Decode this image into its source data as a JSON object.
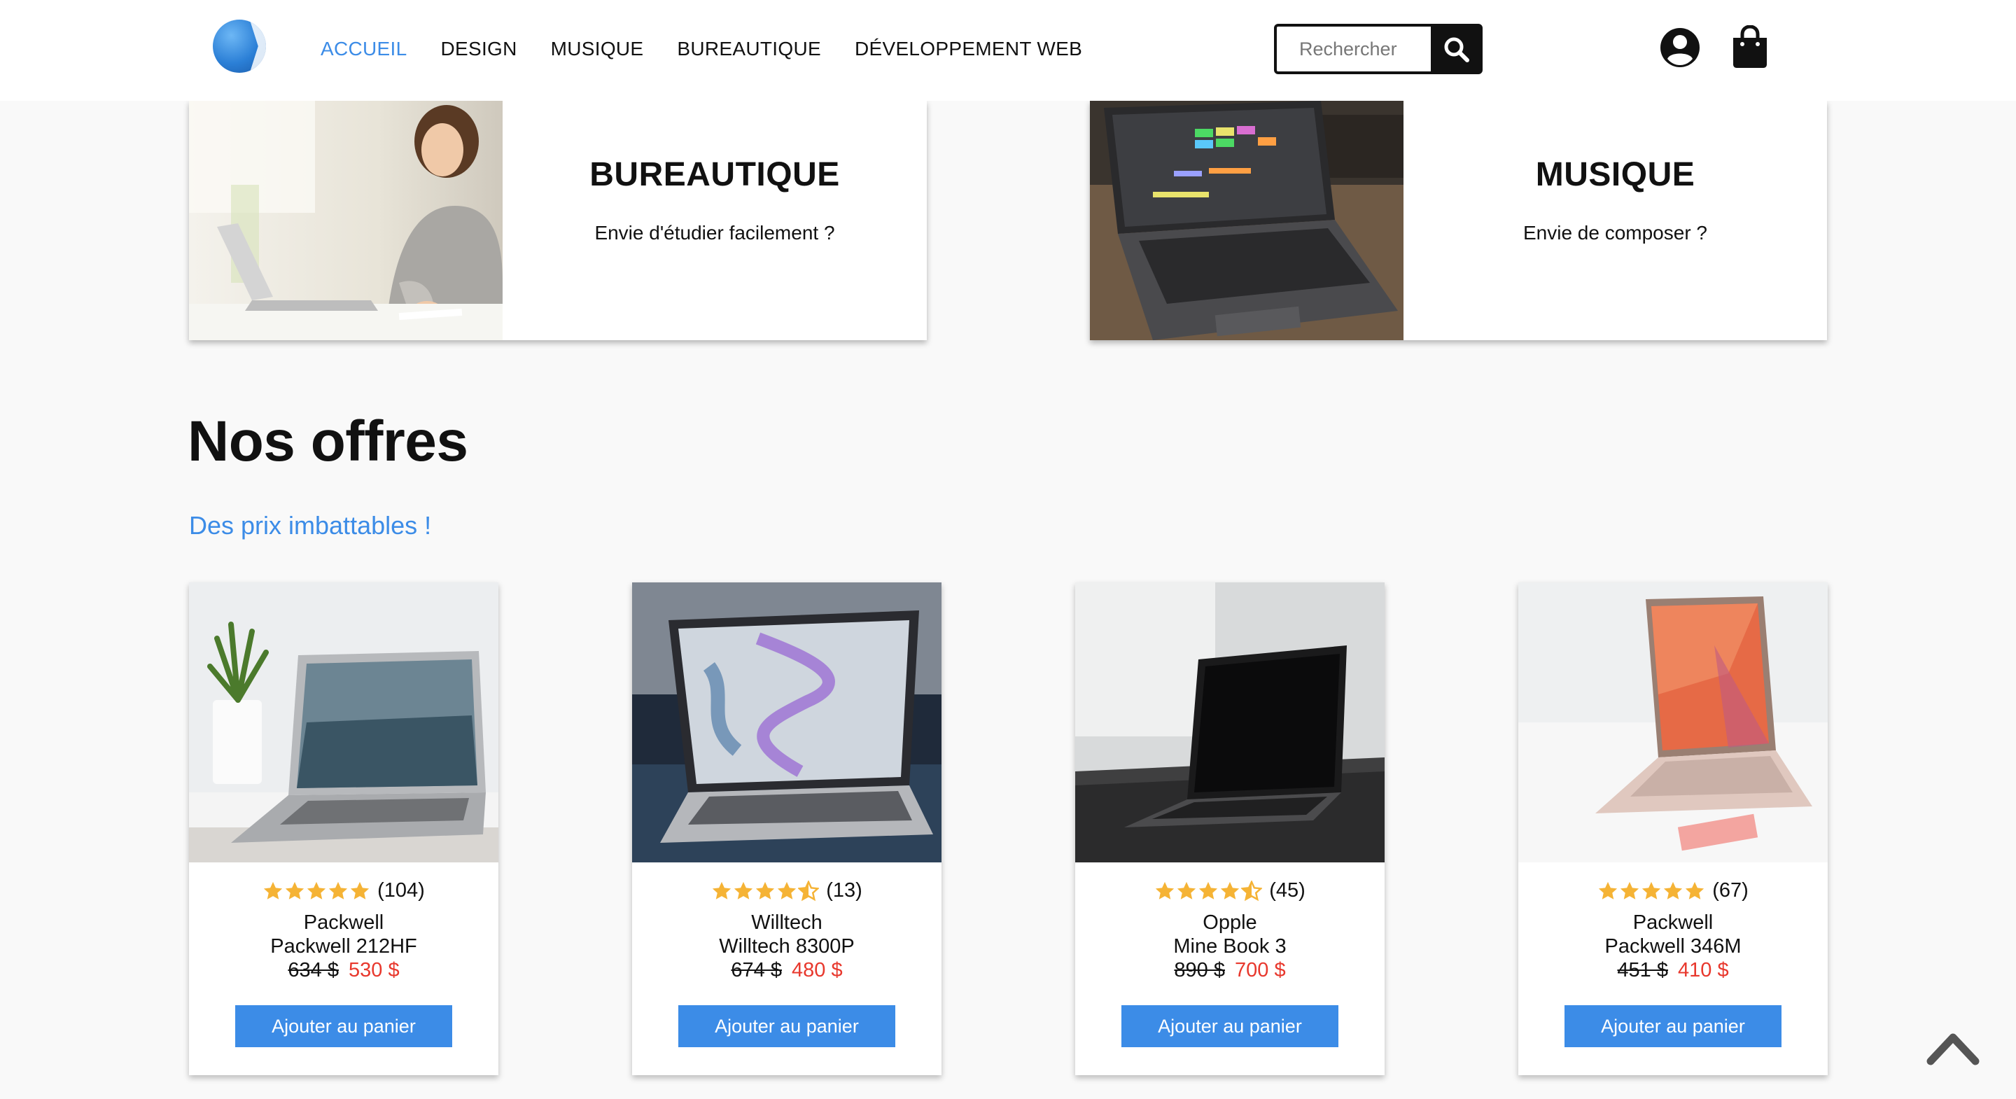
{
  "header": {
    "nav": [
      {
        "label": "ACCUEIL",
        "active": true
      },
      {
        "label": "DESIGN",
        "active": false
      },
      {
        "label": "MUSIQUE",
        "active": false
      },
      {
        "label": "BUREAUTIQUE",
        "active": false
      },
      {
        "label": "DÉVELOPPEMENT WEB",
        "active": false
      }
    ],
    "search_placeholder": "Rechercher",
    "icons": {
      "search": "search-icon",
      "user": "user-circle-icon",
      "cart": "shopping-bag-icon"
    }
  },
  "categories": [
    {
      "title": "BUREAUTIQUE",
      "subtitle": "Envie d'étudier facilement ?"
    },
    {
      "title": "MUSIQUE",
      "subtitle": "Envie de composer ?"
    }
  ],
  "offers": {
    "title": "Nos offres",
    "subtitle": "Des prix imbattables !"
  },
  "products": [
    {
      "stars": 5,
      "reviews": "(104)",
      "brand": "Packwell",
      "model": "Packwell 212HF",
      "old_price": "634 $",
      "new_price": "530 $",
      "button": "Ajouter au panier"
    },
    {
      "stars": 4.5,
      "reviews": "(13)",
      "brand": "Willtech",
      "model": "Willtech 8300P",
      "old_price": "674 $",
      "new_price": "480 $",
      "button": "Ajouter au panier"
    },
    {
      "stars": 4.5,
      "reviews": "(45)",
      "brand": "Opple",
      "model": "Mine Book 3",
      "old_price": "890 $",
      "new_price": "700 $",
      "button": "Ajouter au panier"
    },
    {
      "stars": 5,
      "reviews": "(67)",
      "brand": "Packwell",
      "model": "Packwell 346M",
      "old_price": "451 $",
      "new_price": "410 $",
      "button": "Ajouter au panier"
    }
  ],
  "colors": {
    "accent": "#3c8ce7",
    "price_new": "#e8382d",
    "star": "#f5b335"
  }
}
